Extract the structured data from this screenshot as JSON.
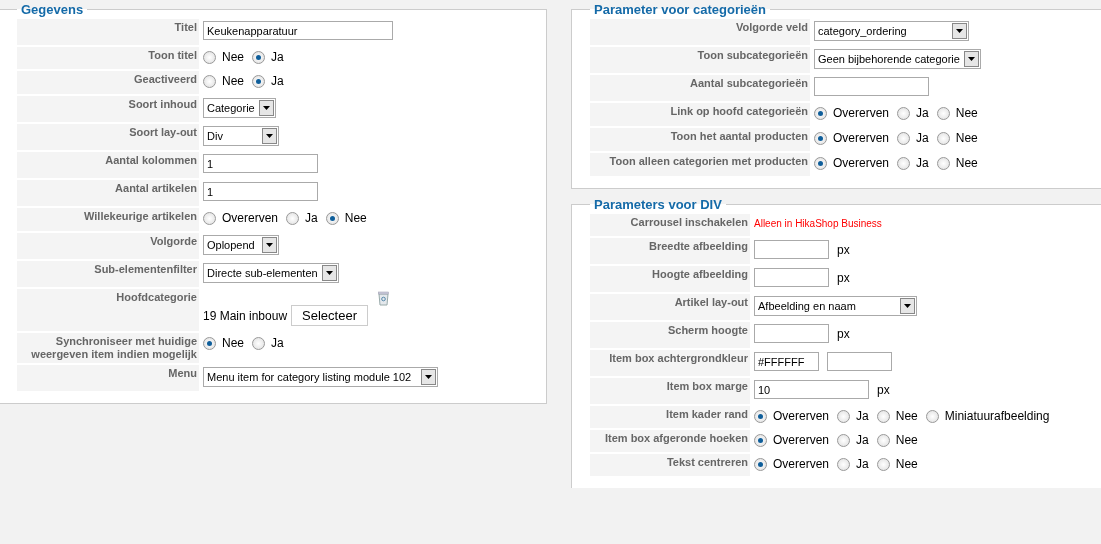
{
  "panels": [
    {
      "title": "Gegevens",
      "rows": [
        {
          "label": "Titel",
          "kind": "text",
          "value": "Keukenapparatuur"
        },
        {
          "label": "Toon titel",
          "kind": "radio",
          "options": [
            {
              "label": "Nee",
              "selected": false
            },
            {
              "label": "Ja",
              "selected": true
            }
          ]
        },
        {
          "label": "Geactiveerd",
          "kind": "radio",
          "options": [
            {
              "label": "Nee",
              "selected": false
            },
            {
              "label": "Ja",
              "selected": true
            }
          ]
        },
        {
          "label": "Soort inhoud",
          "kind": "select",
          "value": "Categorie"
        },
        {
          "label": "Soort lay-out",
          "kind": "select",
          "value": "Div"
        },
        {
          "label": "Aantal kolommen",
          "kind": "text",
          "value": "1"
        },
        {
          "label": "Aantal artikelen",
          "kind": "text",
          "value": "1"
        },
        {
          "label": "Willekeurige artikelen",
          "kind": "radio",
          "options": [
            {
              "label": "Overerven",
              "selected": false
            },
            {
              "label": "Ja",
              "selected": false
            },
            {
              "label": "Nee",
              "selected": true
            }
          ]
        },
        {
          "label": "Volgorde",
          "kind": "select",
          "value": "Oplopend"
        },
        {
          "label": "Sub-elementenfilter",
          "kind": "select",
          "value": "Directe sub-elementen"
        },
        {
          "label": "Hoofdcategorie",
          "kind": "category",
          "value": "19 Main inbouw",
          "button": "Selecteer"
        },
        {
          "label": "Synchroniseer met huidige weergeven item indien mogelijk",
          "kind": "radio",
          "options": [
            {
              "label": "Nee",
              "selected": true
            },
            {
              "label": "Ja",
              "selected": false
            }
          ]
        },
        {
          "label": "Menu",
          "kind": "select",
          "value": "Menu item for category listing module 102"
        }
      ]
    },
    {
      "title": "Parameter voor categorieën",
      "rows": [
        {
          "label": "Volgorde veld",
          "kind": "select",
          "value": "category_ordering"
        },
        {
          "label": "Toon subcategorieën",
          "kind": "select",
          "value": "Geen bijbehorende categorie"
        },
        {
          "label": "Aantal subcategorieën",
          "kind": "text"
        },
        {
          "label": "Link op hoofd categorieën",
          "kind": "radio",
          "options": [
            {
              "label": "Overerven",
              "selected": true
            },
            {
              "label": "Ja",
              "selected": false
            },
            {
              "label": "Nee",
              "selected": false
            }
          ]
        },
        {
          "label": "Toon het aantal producten",
          "kind": "radio",
          "options": [
            {
              "label": "Overerven",
              "selected": true
            },
            {
              "label": "Ja",
              "selected": false
            },
            {
              "label": "Nee",
              "selected": false
            }
          ]
        },
        {
          "label": "Toon alleen categorien met producten",
          "kind": "radio",
          "options": [
            {
              "label": "Overerven",
              "selected": true
            },
            {
              "label": "Ja",
              "selected": false
            },
            {
              "label": "Nee",
              "selected": false
            }
          ]
        }
      ]
    },
    {
      "title": "Parameters voor DIV",
      "rows": [
        {
          "label": "Carrousel inschakelen",
          "kind": "note",
          "text": "Alleen in HikaShop Business"
        },
        {
          "label": "Breedte afbeelding",
          "kind": "text",
          "unit": "px"
        },
        {
          "label": "Hoogte afbeelding",
          "kind": "text",
          "unit": "px"
        },
        {
          "label": "Artikel lay-out",
          "kind": "select",
          "value": "Afbeelding en naam"
        },
        {
          "label": "Scherm hoogte",
          "kind": "text",
          "unit": "px"
        },
        {
          "label": "Item box achtergrondkleur",
          "kind": "color",
          "value": "#FFFFFF"
        },
        {
          "label": "Item box marge",
          "kind": "text",
          "value": "10",
          "unit": "px"
        },
        {
          "label": "Item kader rand",
          "kind": "radio",
          "options": [
            {
              "label": "Overerven",
              "selected": true
            },
            {
              "label": "Ja",
              "selected": false
            },
            {
              "label": "Nee",
              "selected": false
            },
            {
              "label": "Miniatuurafbeelding",
              "selected": false
            }
          ]
        },
        {
          "label": "Item box afgeronde hoeken",
          "kind": "radio",
          "options": [
            {
              "label": "Overerven",
              "selected": true
            },
            {
              "label": "Ja",
              "selected": false
            },
            {
              "label": "Nee",
              "selected": false
            }
          ]
        },
        {
          "label": "Tekst centreren",
          "kind": "radio",
          "options": [
            {
              "label": "Overerven",
              "selected": true
            },
            {
              "label": "Ja",
              "selected": false
            },
            {
              "label": "Nee",
              "selected": false
            }
          ]
        }
      ]
    }
  ]
}
